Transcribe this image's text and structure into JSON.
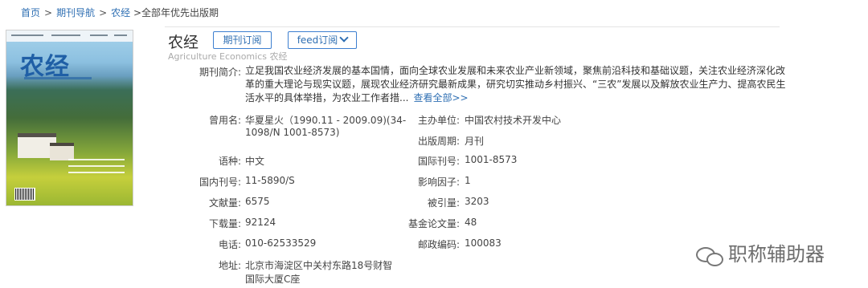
{
  "breadcrumb": {
    "home": "首页",
    "journal_nav": "期刊导航",
    "category": "农经",
    "current": ">全部年优先出版期",
    "sep": ">"
  },
  "journal": {
    "title": "农经",
    "subscribe_label": "期刊订阅",
    "feed_label": "feed订阅",
    "english_title": "Agriculture Economics  农经",
    "cover_title": "农经"
  },
  "intro": {
    "label": "期刊简介:",
    "text": "立足我国农业经济发展的基本国情，面向全球农业发展和未来农业产业新领域，聚焦前沿科技和基础议题，关注农业经济深化改革的重大理论与现实议题，展现农业经济研究最新成果，研究切实推动乡村振兴、“三农”发展以及解放农业生产力、提高农民生活水平的具体举措，为农业工作者措...",
    "more_label": "查看全部>>"
  },
  "left_fields": [
    {
      "label": "曾用名:",
      "value": "华夏星火（1990.11 - 2009.09)(34-",
      "value2": "1098/N 1001-8573)"
    },
    {
      "label": "语种:",
      "value": "中文"
    },
    {
      "label": "国内刊号:",
      "value": "11-5890/S"
    },
    {
      "label": "文献量:",
      "value": "6575"
    },
    {
      "label": "下载量:",
      "value": "92124"
    },
    {
      "label": "电话:",
      "value": "010-62533529"
    },
    {
      "label": "地址:",
      "value": "北京市海淀区中关村东路18号财智",
      "value2": "国际大厦C座"
    }
  ],
  "right_fields": [
    {
      "label": "主办单位:",
      "value": "中国农村技术开发中心"
    },
    {
      "label": "出版周期:",
      "value": "月刊"
    },
    {
      "label": "国际刊号:",
      "value": "1001-8573"
    },
    {
      "label": "影响因子:",
      "value": "1"
    },
    {
      "label": "被引量:",
      "value": "3203"
    },
    {
      "label": "基金论文量:",
      "value": "48"
    },
    {
      "label": "邮政编码:",
      "value": "100083"
    }
  ],
  "watermark": {
    "text": "职称辅助器",
    "icon": "wechat-icon"
  }
}
